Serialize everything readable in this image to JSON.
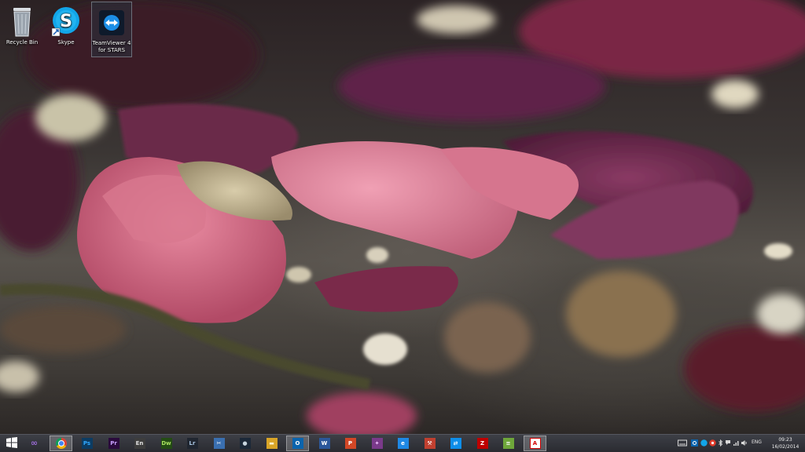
{
  "desktop_icons": [
    {
      "label": "Recycle Bin",
      "icon": "recycle-bin-icon"
    },
    {
      "label": "Skype",
      "icon": "skype-icon",
      "glyph": "S",
      "shortcut": true
    },
    {
      "label": "TeamViewer 4 for STARS",
      "icon": "teamviewer-icon",
      "selected": true
    }
  ],
  "taskbar": {
    "start_icon": "windows-start-icon",
    "apps": [
      {
        "name": "visual-studio",
        "glyph": "VS",
        "color": "#68217a",
        "active": false
      },
      {
        "name": "chrome",
        "glyph": "",
        "color": "#4285f4",
        "active": true
      },
      {
        "name": "photoshop",
        "glyph": "Ps",
        "color": "#0c3c63",
        "text_color": "#31a8ff",
        "active": false
      },
      {
        "name": "premiere",
        "glyph": "Pr",
        "color": "#2a0a3c",
        "text_color": "#c8a0ff",
        "active": false
      },
      {
        "name": "encore",
        "glyph": "En",
        "color": "#3d3d3d",
        "text_color": "#e0e0e0",
        "active": false
      },
      {
        "name": "dreamweaver",
        "glyph": "Dw",
        "color": "#244c14",
        "text_color": "#a8e060",
        "active": false
      },
      {
        "name": "lightroom",
        "glyph": "Lr",
        "color": "#202630",
        "text_color": "#a8c4e0",
        "active": false
      },
      {
        "name": "snipping",
        "glyph": "✂",
        "color": "#3a6fb0",
        "text_color": "#ffffff",
        "active": false
      },
      {
        "name": "steam",
        "glyph": "●",
        "color": "#1b2838",
        "text_color": "#c7d5e0",
        "active": false
      },
      {
        "name": "explorer",
        "glyph": "▬",
        "color": "#d9a527",
        "text_color": "#fff4cc",
        "active": false
      },
      {
        "name": "outlook",
        "glyph": "O",
        "color": "#0a64ad",
        "text_color": "#ffffff",
        "active": true
      },
      {
        "name": "word",
        "glyph": "W",
        "color": "#2b579a",
        "text_color": "#ffffff",
        "active": false
      },
      {
        "name": "powerpoint",
        "glyph": "P",
        "color": "#d24726",
        "text_color": "#ffffff",
        "active": false
      },
      {
        "name": "onenote",
        "glyph": "✦",
        "color": "#7a3a8a",
        "text_color": "#f0c0ff",
        "active": false
      },
      {
        "name": "internet-explorer",
        "glyph": "e",
        "color": "#1e88e5",
        "text_color": "#ffffff",
        "active": false
      },
      {
        "name": "tools",
        "glyph": "⚒",
        "color": "#c04030",
        "text_color": "#ffffff",
        "active": false
      },
      {
        "name": "teamviewer",
        "glyph": "⇄",
        "color": "#0e8ee9",
        "text_color": "#ffffff",
        "active": false
      },
      {
        "name": "filezilla",
        "glyph": "Z",
        "color": "#bf0000",
        "text_color": "#ffffff",
        "active": false
      },
      {
        "name": "notepad",
        "glyph": "≡",
        "color": "#6ea63a",
        "text_color": "#ffffff",
        "active": false
      },
      {
        "name": "adobe-reader",
        "glyph": "A",
        "color": "#ffffff",
        "text_color": "#d00000",
        "active": true
      }
    ]
  },
  "tray": {
    "icons": [
      "keyboard-icon",
      "outlook-tray-icon",
      "skype-tray-icon",
      "antivirus-icon",
      "bluetooth-icon",
      "action-center-icon",
      "network-icon",
      "volume-icon",
      "power-icon"
    ],
    "language": "ENG",
    "time": "09:23",
    "date": "16/02/2014"
  }
}
